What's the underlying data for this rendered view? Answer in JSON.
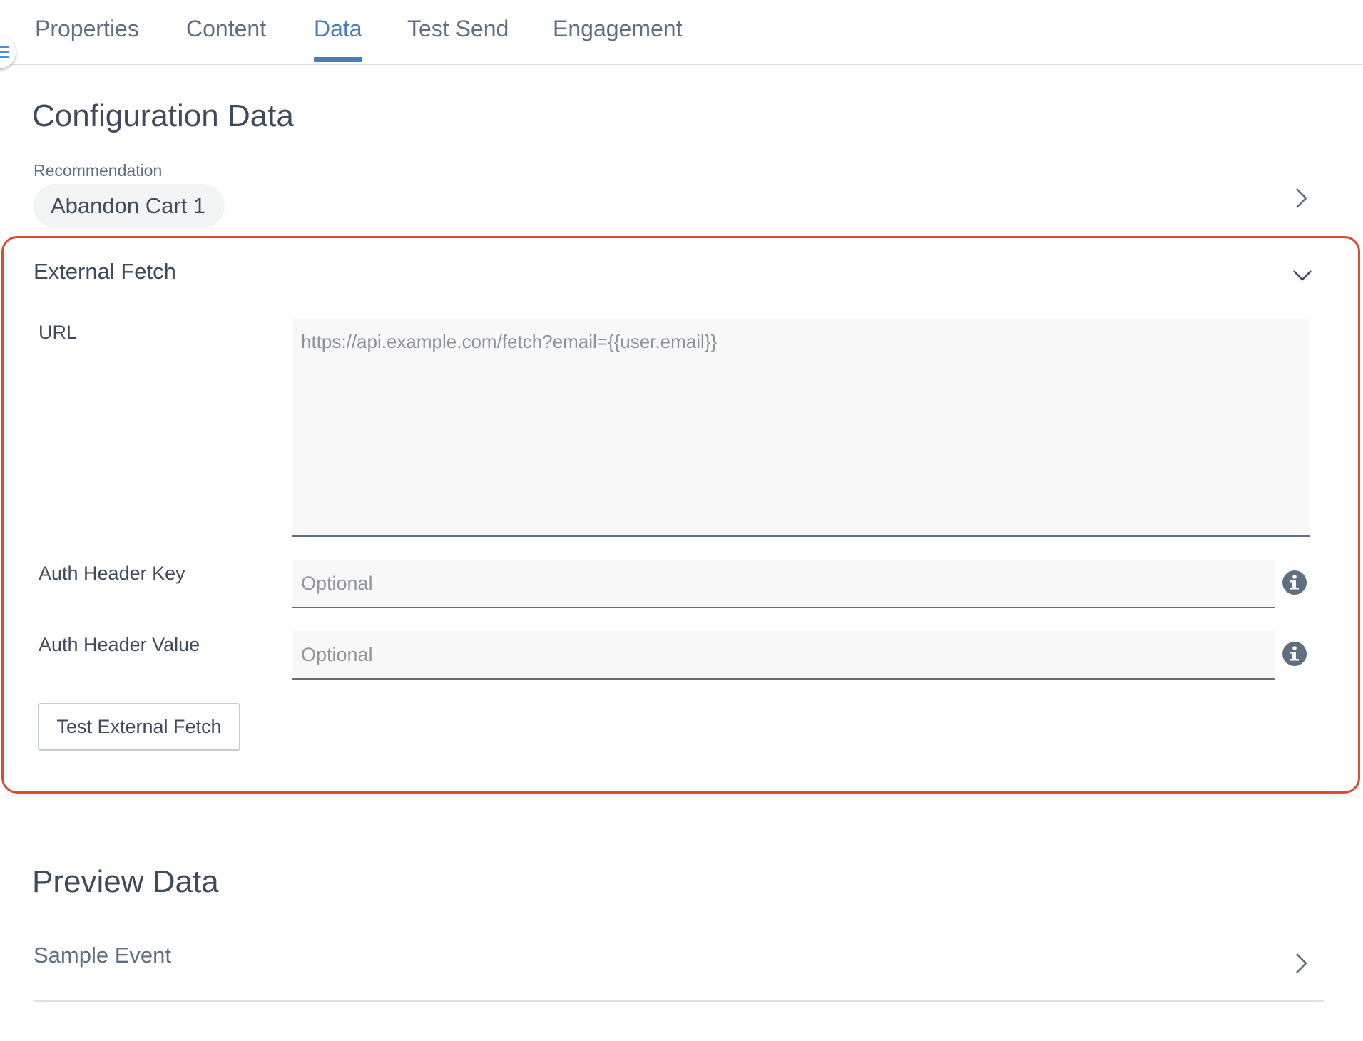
{
  "tabs": [
    {
      "label": "Properties",
      "active": false
    },
    {
      "label": "Content",
      "active": false
    },
    {
      "label": "Data",
      "active": true
    },
    {
      "label": "Test Send",
      "active": false
    },
    {
      "label": "Engagement",
      "active": false
    }
  ],
  "config": {
    "title": "Configuration Data",
    "recommendation_label": "Recommendation",
    "recommendation_value": "Abandon Cart 1"
  },
  "external_fetch": {
    "title": "External Fetch",
    "url_label": "URL",
    "url_value": "https://api.example.com/fetch?email={{user.email}}",
    "auth_key_label": "Auth Header Key",
    "auth_key_placeholder": "Optional",
    "auth_value_label": "Auth Header Value",
    "auth_value_placeholder": "Optional",
    "test_button": "Test External Fetch"
  },
  "preview": {
    "title": "Preview Data",
    "sample_event_label": "Sample Event"
  },
  "colors": {
    "accent": "#4a7eb5",
    "highlight_border": "#e04a2f",
    "text": "#3d4b5c",
    "muted_text": "#5f6f80"
  }
}
